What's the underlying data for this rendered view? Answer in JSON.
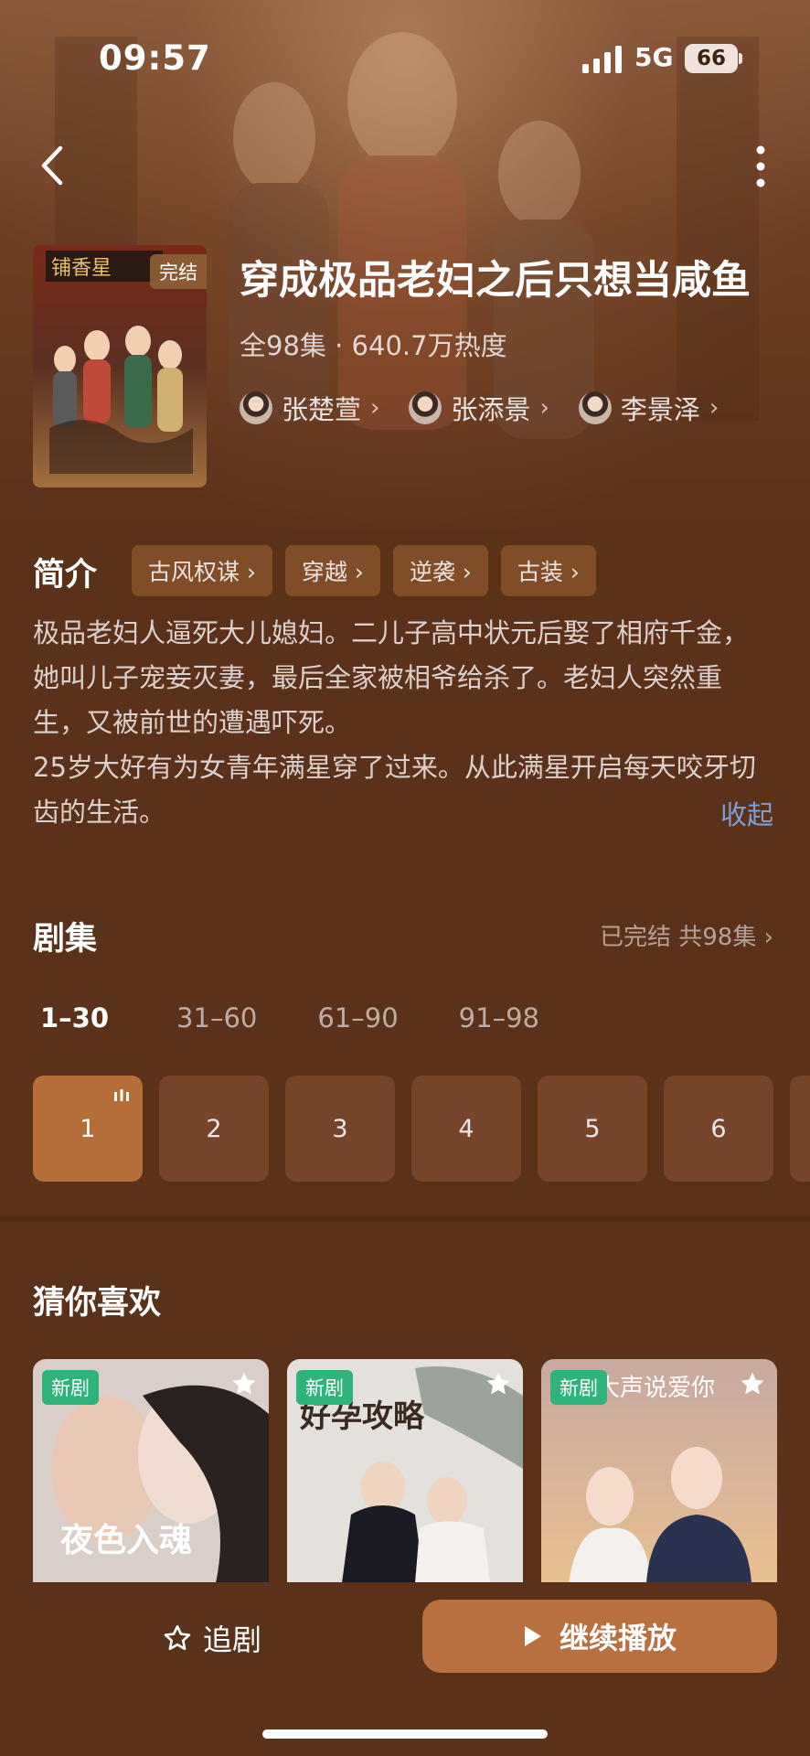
{
  "status_bar": {
    "time": "09:57",
    "network": "5G",
    "battery": "66"
  },
  "header": {
    "back_icon": "chevron-left-icon",
    "more_icon": "more-vertical-icon"
  },
  "drama": {
    "poster_badge": "完结",
    "poster_sign": "铺香星",
    "title": "穿成极品老妇之后只想当咸鱼",
    "meta": "全98集 · 640.7万热度",
    "cast": [
      {
        "name": "张楚萱"
      },
      {
        "name": "张添景"
      },
      {
        "name": "李景泽"
      }
    ]
  },
  "intro": {
    "label": "简介",
    "tags": [
      "古风权谋",
      "穿越",
      "逆袭",
      "古装"
    ],
    "paragraphs": [
      "极品老妇人逼死大儿媳妇。二儿子高中状元后娶了相府千金，她叫儿子宠妾灭妻，最后全家被相爷给杀了。老妇人突然重生，又被前世的遭遇吓死。",
      "25岁大好有为女青年满星穿了过来。从此满星开启每天咬牙切齿的生活。"
    ],
    "collapse_label": "收起"
  },
  "episodes": {
    "label": "剧集",
    "status": "已完结 共98集",
    "ranges": [
      "1–30",
      "31–60",
      "61–90",
      "91–98"
    ],
    "active_range": 0,
    "items": [
      "1",
      "2",
      "3",
      "4",
      "5",
      "6"
    ],
    "playing_index": 0
  },
  "recommend": {
    "label": "猜你喜欢",
    "items": [
      {
        "badge": "新剧",
        "cover_text": "夜色入魂"
      },
      {
        "badge": "新剧",
        "cover_text": "好孕攻略"
      },
      {
        "badge": "新剧",
        "cover_text": "只想大声说爱你"
      }
    ]
  },
  "actions": {
    "follow_label": "追剧",
    "play_label": "继续播放"
  },
  "colors": {
    "background": "#5a3119",
    "accent": "#b87040",
    "new_badge": "#2eb37a",
    "link": "#7f9ed8"
  }
}
